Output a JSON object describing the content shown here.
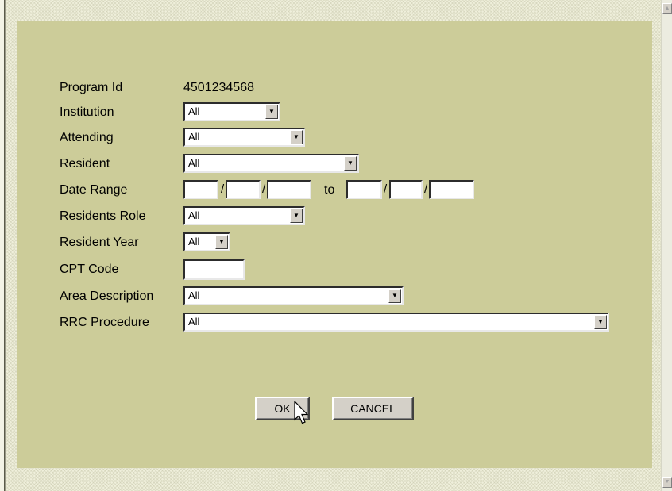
{
  "form": {
    "program_id_label": "Program Id",
    "program_id_value": "4501234568",
    "institution_label": "Institution",
    "institution_value": "All",
    "attending_label": "Attending",
    "attending_value": "All",
    "resident_label": "Resident",
    "resident_value": "All",
    "date_range_label": "Date Range",
    "date_separator": "/",
    "date_to_label": "to",
    "residents_role_label": "Residents Role",
    "residents_role_value": "All",
    "resident_year_label": "Resident Year",
    "resident_year_value": "All",
    "cpt_code_label": "CPT Code",
    "area_description_label": "Area Description",
    "area_description_value": "All",
    "rrc_procedure_label": "RRC Procedure",
    "rrc_procedure_value": "All"
  },
  "buttons": {
    "ok_label": "OK",
    "cancel_label": "CANCEL"
  },
  "icons": {
    "dropdown": "chevron-down-icon",
    "cursor": "mouse-pointer-icon",
    "scroll_up": "scroll-up-arrow-icon",
    "scroll_down": "scroll-down-arrow-icon"
  },
  "colors": {
    "panel_background": "#cccc99",
    "page_background": "#efefdb",
    "button_face": "#d4d0c8"
  }
}
